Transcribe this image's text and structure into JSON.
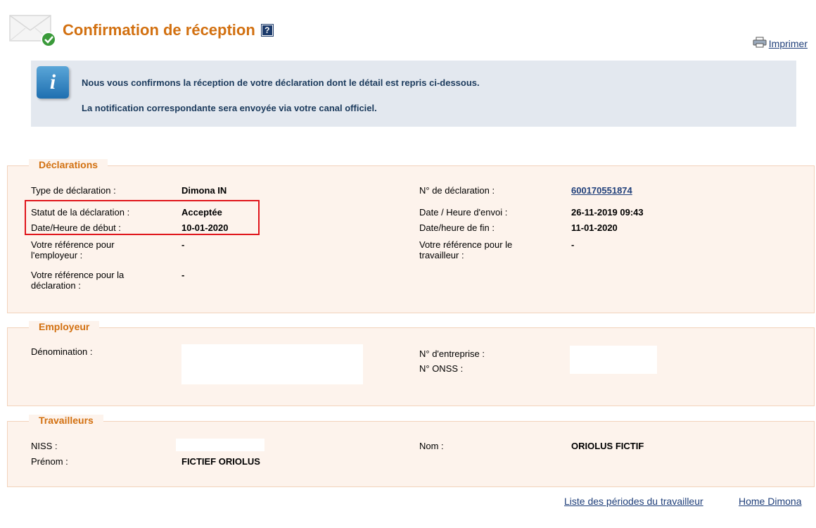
{
  "header": {
    "title": "Confirmation de réception",
    "help_glyph": "?",
    "print_label": "Imprimer"
  },
  "info": {
    "icon_glyph": "i",
    "line1": "Nous vous confirmons la réception de votre déclaration dont le détail est repris ci-dessous.",
    "line2": "La notification correspondante sera envoyée via votre canal officiel."
  },
  "declarations": {
    "legend": "Déclarations",
    "type_label": "Type de déclaration :",
    "type_value": "Dimona IN",
    "statut_label": "Statut de la déclaration :",
    "statut_value": "Acceptée",
    "debut_label": "Date/Heure de début :",
    "debut_value": "10-01-2020",
    "ref_employeur_label": "Votre référence pour l'employeur :",
    "ref_employeur_value": "-",
    "ref_declaration_label": "Votre référence pour la déclaration :",
    "ref_declaration_value": "-",
    "numero_label": "N° de déclaration :",
    "numero_value": "600170551874",
    "envoi_label": "Date / Heure d'envoi :",
    "envoi_value": "26-11-2019 09:43",
    "fin_label": "Date/heure de fin :",
    "fin_value": "11-01-2020",
    "ref_travailleur_label": "Votre référence pour le travailleur :",
    "ref_travailleur_value": "-"
  },
  "employeur": {
    "legend": "Employeur",
    "denomination_label": "Dénomination :",
    "entreprise_label": "N° d'entreprise :",
    "onss_label": "N° ONSS :"
  },
  "travailleurs": {
    "legend": "Travailleurs",
    "niss_label": "NISS :",
    "prenom_label": "Prénom :",
    "prenom_value": "FICTIEF ORIOLUS",
    "nom_label": "Nom :",
    "nom_value": "ORIOLUS FICTIF"
  },
  "footer": {
    "periodes_link": "Liste des périodes du travailleur",
    "home_link": "Home Dimona"
  },
  "colors": {
    "title_orange": "#d27010",
    "link_blue": "#1f3f7a",
    "info_bg": "#e3e8ef",
    "section_bg": "#fdf3ec",
    "highlight_red": "#e0151b"
  },
  "icons": {
    "header": "envelope-check-icon",
    "help": "help-icon",
    "print": "printer-icon",
    "info": "info-icon"
  }
}
